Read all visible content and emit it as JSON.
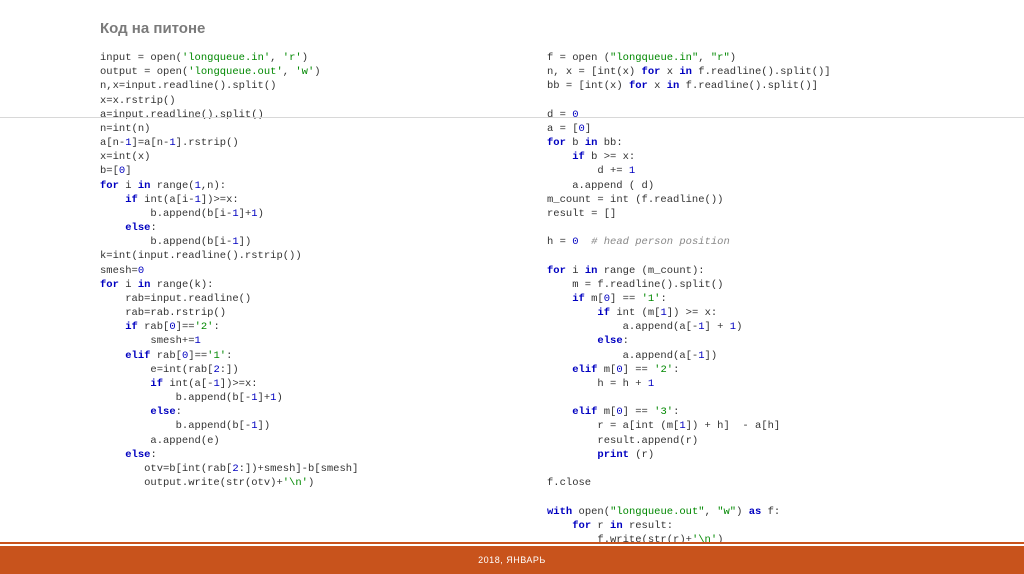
{
  "title": "Код на питоне",
  "footer": "2018, ЯНВАРЬ",
  "code_left": {
    "lines": [
      [
        {
          "t": "input = ",
          "c": "nm"
        },
        {
          "t": "open",
          "c": "nm"
        },
        {
          "t": "(",
          "c": "nm"
        },
        {
          "t": "'longqueue.in'",
          "c": "str"
        },
        {
          "t": ", ",
          "c": "nm"
        },
        {
          "t": "'r'",
          "c": "str"
        },
        {
          "t": ")",
          "c": "nm"
        }
      ],
      [
        {
          "t": "output = ",
          "c": "nm"
        },
        {
          "t": "open",
          "c": "nm"
        },
        {
          "t": "(",
          "c": "nm"
        },
        {
          "t": "'longqueue.out'",
          "c": "str"
        },
        {
          "t": ", ",
          "c": "nm"
        },
        {
          "t": "'w'",
          "c": "str"
        },
        {
          "t": ")",
          "c": "nm"
        }
      ],
      [
        {
          "t": "n,x=input.readline().split()",
          "c": "nm"
        }
      ],
      [
        {
          "t": "x=x.rstrip()",
          "c": "nm"
        }
      ],
      [
        {
          "t": "a=input.readline().split()",
          "c": "nm"
        }
      ],
      [
        {
          "t": "n=",
          "c": "nm"
        },
        {
          "t": "int",
          "c": "nm"
        },
        {
          "t": "(n)",
          "c": "nm"
        }
      ],
      [
        {
          "t": "a[n-",
          "c": "nm"
        },
        {
          "t": "1",
          "c": "num"
        },
        {
          "t": "]=a[n-",
          "c": "nm"
        },
        {
          "t": "1",
          "c": "num"
        },
        {
          "t": "].rstrip()",
          "c": "nm"
        }
      ],
      [
        {
          "t": "x=",
          "c": "nm"
        },
        {
          "t": "int",
          "c": "nm"
        },
        {
          "t": "(x)",
          "c": "nm"
        }
      ],
      [
        {
          "t": "b=[",
          "c": "nm"
        },
        {
          "t": "0",
          "c": "num"
        },
        {
          "t": "]",
          "c": "nm"
        }
      ],
      [
        {
          "t": "for",
          "c": "kw"
        },
        {
          "t": " i ",
          "c": "nm"
        },
        {
          "t": "in",
          "c": "kw"
        },
        {
          "t": " ",
          "c": "nm"
        },
        {
          "t": "range",
          "c": "nm"
        },
        {
          "t": "(",
          "c": "nm"
        },
        {
          "t": "1",
          "c": "num"
        },
        {
          "t": ",n):",
          "c": "nm"
        }
      ],
      [
        {
          "t": "    ",
          "c": "nm"
        },
        {
          "t": "if",
          "c": "kw"
        },
        {
          "t": " ",
          "c": "nm"
        },
        {
          "t": "int",
          "c": "nm"
        },
        {
          "t": "(a[i-",
          "c": "nm"
        },
        {
          "t": "1",
          "c": "num"
        },
        {
          "t": "])>=x:",
          "c": "nm"
        }
      ],
      [
        {
          "t": "        b.append(b[i-",
          "c": "nm"
        },
        {
          "t": "1",
          "c": "num"
        },
        {
          "t": "]+",
          "c": "nm"
        },
        {
          "t": "1",
          "c": "num"
        },
        {
          "t": ")",
          "c": "nm"
        }
      ],
      [
        {
          "t": "    ",
          "c": "nm"
        },
        {
          "t": "else",
          "c": "kw"
        },
        {
          "t": ":",
          "c": "nm"
        }
      ],
      [
        {
          "t": "        b.append(b[i-",
          "c": "nm"
        },
        {
          "t": "1",
          "c": "num"
        },
        {
          "t": "])",
          "c": "nm"
        }
      ],
      [
        {
          "t": "k=",
          "c": "nm"
        },
        {
          "t": "int",
          "c": "nm"
        },
        {
          "t": "(input.readline().rstrip())",
          "c": "nm"
        }
      ],
      [
        {
          "t": "smesh=",
          "c": "nm"
        },
        {
          "t": "0",
          "c": "num"
        }
      ],
      [
        {
          "t": "for",
          "c": "kw"
        },
        {
          "t": " i ",
          "c": "nm"
        },
        {
          "t": "in",
          "c": "kw"
        },
        {
          "t": " ",
          "c": "nm"
        },
        {
          "t": "range",
          "c": "nm"
        },
        {
          "t": "(k):",
          "c": "nm"
        }
      ],
      [
        {
          "t": "    rab=input.readline()",
          "c": "nm"
        }
      ],
      [
        {
          "t": "    rab=rab.rstrip()",
          "c": "nm"
        }
      ],
      [
        {
          "t": "    ",
          "c": "nm"
        },
        {
          "t": "if",
          "c": "kw"
        },
        {
          "t": " rab[",
          "c": "nm"
        },
        {
          "t": "0",
          "c": "num"
        },
        {
          "t": "]==",
          "c": "nm"
        },
        {
          "t": "'2'",
          "c": "str"
        },
        {
          "t": ":",
          "c": "nm"
        }
      ],
      [
        {
          "t": "        smesh+=",
          "c": "nm"
        },
        {
          "t": "1",
          "c": "num"
        }
      ],
      [
        {
          "t": "    ",
          "c": "nm"
        },
        {
          "t": "elif",
          "c": "kw"
        },
        {
          "t": " rab[",
          "c": "nm"
        },
        {
          "t": "0",
          "c": "num"
        },
        {
          "t": "]==",
          "c": "nm"
        },
        {
          "t": "'1'",
          "c": "str"
        },
        {
          "t": ":",
          "c": "nm"
        }
      ],
      [
        {
          "t": "        e=",
          "c": "nm"
        },
        {
          "t": "int",
          "c": "nm"
        },
        {
          "t": "(rab[",
          "c": "nm"
        },
        {
          "t": "2",
          "c": "num"
        },
        {
          "t": ":])",
          "c": "nm"
        }
      ],
      [
        {
          "t": "        ",
          "c": "nm"
        },
        {
          "t": "if",
          "c": "kw"
        },
        {
          "t": " ",
          "c": "nm"
        },
        {
          "t": "int",
          "c": "nm"
        },
        {
          "t": "(a[-",
          "c": "nm"
        },
        {
          "t": "1",
          "c": "num"
        },
        {
          "t": "])>=x:",
          "c": "nm"
        }
      ],
      [
        {
          "t": "            b.append(b[-",
          "c": "nm"
        },
        {
          "t": "1",
          "c": "num"
        },
        {
          "t": "]+",
          "c": "nm"
        },
        {
          "t": "1",
          "c": "num"
        },
        {
          "t": ")",
          "c": "nm"
        }
      ],
      [
        {
          "t": "        ",
          "c": "nm"
        },
        {
          "t": "else",
          "c": "kw"
        },
        {
          "t": ":",
          "c": "nm"
        }
      ],
      [
        {
          "t": "            b.append(b[-",
          "c": "nm"
        },
        {
          "t": "1",
          "c": "num"
        },
        {
          "t": "])",
          "c": "nm"
        }
      ],
      [
        {
          "t": "        a.append(e)",
          "c": "nm"
        }
      ],
      [
        {
          "t": "    ",
          "c": "nm"
        },
        {
          "t": "else",
          "c": "kw"
        },
        {
          "t": ":",
          "c": "nm"
        }
      ],
      [
        {
          "t": "       otv=b[",
          "c": "nm"
        },
        {
          "t": "int",
          "c": "nm"
        },
        {
          "t": "(rab[",
          "c": "nm"
        },
        {
          "t": "2",
          "c": "num"
        },
        {
          "t": ":])+smesh]-b[smesh]",
          "c": "nm"
        }
      ],
      [
        {
          "t": "       output.write(",
          "c": "nm"
        },
        {
          "t": "str",
          "c": "nm"
        },
        {
          "t": "(otv)+",
          "c": "nm"
        },
        {
          "t": "'\\n'",
          "c": "str"
        },
        {
          "t": ")",
          "c": "nm"
        }
      ]
    ]
  },
  "code_right": {
    "lines": [
      [
        {
          "t": "f = ",
          "c": "nm"
        },
        {
          "t": "open",
          "c": "nm"
        },
        {
          "t": " (",
          "c": "nm"
        },
        {
          "t": "\"longqueue.in\"",
          "c": "str"
        },
        {
          "t": ", ",
          "c": "nm"
        },
        {
          "t": "\"r\"",
          "c": "str"
        },
        {
          "t": ")",
          "c": "nm"
        }
      ],
      [
        {
          "t": "n, x = [",
          "c": "nm"
        },
        {
          "t": "int",
          "c": "nm"
        },
        {
          "t": "(x) ",
          "c": "nm"
        },
        {
          "t": "for",
          "c": "kw"
        },
        {
          "t": " x ",
          "c": "nm"
        },
        {
          "t": "in",
          "c": "kw"
        },
        {
          "t": " f.readline().split()]",
          "c": "nm"
        }
      ],
      [
        {
          "t": "bb = [",
          "c": "nm"
        },
        {
          "t": "int",
          "c": "nm"
        },
        {
          "t": "(x) ",
          "c": "nm"
        },
        {
          "t": "for",
          "c": "kw"
        },
        {
          "t": " x ",
          "c": "nm"
        },
        {
          "t": "in",
          "c": "kw"
        },
        {
          "t": " f.readline().split()]",
          "c": "nm"
        }
      ],
      [],
      [
        {
          "t": "d = ",
          "c": "nm"
        },
        {
          "t": "0",
          "c": "num"
        }
      ],
      [
        {
          "t": "a = [",
          "c": "nm"
        },
        {
          "t": "0",
          "c": "num"
        },
        {
          "t": "]",
          "c": "nm"
        }
      ],
      [
        {
          "t": "for",
          "c": "kw"
        },
        {
          "t": " b ",
          "c": "nm"
        },
        {
          "t": "in",
          "c": "kw"
        },
        {
          "t": " bb:",
          "c": "nm"
        }
      ],
      [
        {
          "t": "    ",
          "c": "nm"
        },
        {
          "t": "if",
          "c": "kw"
        },
        {
          "t": " b >= x:",
          "c": "nm"
        }
      ],
      [
        {
          "t": "        d += ",
          "c": "nm"
        },
        {
          "t": "1",
          "c": "num"
        }
      ],
      [
        {
          "t": "    a.append ( d)",
          "c": "nm"
        }
      ],
      [
        {
          "t": "m_count = ",
          "c": "nm"
        },
        {
          "t": "int",
          "c": "nm"
        },
        {
          "t": " (f.readline())",
          "c": "nm"
        }
      ],
      [
        {
          "t": "result = []",
          "c": "nm"
        }
      ],
      [],
      [
        {
          "t": "h = ",
          "c": "nm"
        },
        {
          "t": "0",
          "c": "num"
        },
        {
          "t": "  ",
          "c": "nm"
        },
        {
          "t": "# head person position",
          "c": "cm"
        }
      ],
      [],
      [
        {
          "t": "for",
          "c": "kw"
        },
        {
          "t": " i ",
          "c": "nm"
        },
        {
          "t": "in",
          "c": "kw"
        },
        {
          "t": " ",
          "c": "nm"
        },
        {
          "t": "range",
          "c": "nm"
        },
        {
          "t": " (m_count):",
          "c": "nm"
        }
      ],
      [
        {
          "t": "    m = f.readline().split()",
          "c": "nm"
        }
      ],
      [
        {
          "t": "    ",
          "c": "nm"
        },
        {
          "t": "if",
          "c": "kw"
        },
        {
          "t": " m[",
          "c": "nm"
        },
        {
          "t": "0",
          "c": "num"
        },
        {
          "t": "] == ",
          "c": "nm"
        },
        {
          "t": "'1'",
          "c": "str"
        },
        {
          "t": ":",
          "c": "nm"
        }
      ],
      [
        {
          "t": "        ",
          "c": "nm"
        },
        {
          "t": "if",
          "c": "kw"
        },
        {
          "t": " ",
          "c": "nm"
        },
        {
          "t": "int",
          "c": "nm"
        },
        {
          "t": " (m[",
          "c": "nm"
        },
        {
          "t": "1",
          "c": "num"
        },
        {
          "t": "]) >= x:",
          "c": "nm"
        }
      ],
      [
        {
          "t": "            a.append(a[-",
          "c": "nm"
        },
        {
          "t": "1",
          "c": "num"
        },
        {
          "t": "] + ",
          "c": "nm"
        },
        {
          "t": "1",
          "c": "num"
        },
        {
          "t": ")",
          "c": "nm"
        }
      ],
      [
        {
          "t": "        ",
          "c": "nm"
        },
        {
          "t": "else",
          "c": "kw"
        },
        {
          "t": ":",
          "c": "nm"
        }
      ],
      [
        {
          "t": "            a.append(a[-",
          "c": "nm"
        },
        {
          "t": "1",
          "c": "num"
        },
        {
          "t": "])",
          "c": "nm"
        }
      ],
      [
        {
          "t": "    ",
          "c": "nm"
        },
        {
          "t": "elif",
          "c": "kw"
        },
        {
          "t": " m[",
          "c": "nm"
        },
        {
          "t": "0",
          "c": "num"
        },
        {
          "t": "] == ",
          "c": "nm"
        },
        {
          "t": "'2'",
          "c": "str"
        },
        {
          "t": ":",
          "c": "nm"
        }
      ],
      [
        {
          "t": "        h = h + ",
          "c": "nm"
        },
        {
          "t": "1",
          "c": "num"
        }
      ],
      [],
      [
        {
          "t": "    ",
          "c": "nm"
        },
        {
          "t": "elif",
          "c": "kw"
        },
        {
          "t": " m[",
          "c": "nm"
        },
        {
          "t": "0",
          "c": "num"
        },
        {
          "t": "] == ",
          "c": "nm"
        },
        {
          "t": "'3'",
          "c": "str"
        },
        {
          "t": ":",
          "c": "nm"
        }
      ],
      [
        {
          "t": "        r = a[",
          "c": "nm"
        },
        {
          "t": "int",
          "c": "nm"
        },
        {
          "t": " (m[",
          "c": "nm"
        },
        {
          "t": "1",
          "c": "num"
        },
        {
          "t": "]) + h]  - a[h]",
          "c": "nm"
        }
      ],
      [
        {
          "t": "        result.append(r)",
          "c": "nm"
        }
      ],
      [
        {
          "t": "        ",
          "c": "nm"
        },
        {
          "t": "print",
          "c": "kw"
        },
        {
          "t": " (r)",
          "c": "nm"
        }
      ],
      [],
      [
        {
          "t": "f.close",
          "c": "nm"
        }
      ],
      [],
      [
        {
          "t": "with",
          "c": "kw"
        },
        {
          "t": " ",
          "c": "nm"
        },
        {
          "t": "open",
          "c": "nm"
        },
        {
          "t": "(",
          "c": "nm"
        },
        {
          "t": "\"longqueue.out\"",
          "c": "str"
        },
        {
          "t": ", ",
          "c": "nm"
        },
        {
          "t": "\"w\"",
          "c": "str"
        },
        {
          "t": ") ",
          "c": "nm"
        },
        {
          "t": "as",
          "c": "kw"
        },
        {
          "t": " f:",
          "c": "nm"
        }
      ],
      [
        {
          "t": "    ",
          "c": "nm"
        },
        {
          "t": "for",
          "c": "kw"
        },
        {
          "t": " r ",
          "c": "nm"
        },
        {
          "t": "in",
          "c": "kw"
        },
        {
          "t": " result:",
          "c": "nm"
        }
      ],
      [
        {
          "t": "        f.write(",
          "c": "nm"
        },
        {
          "t": "str",
          "c": "nm"
        },
        {
          "t": "(r)+",
          "c": "nm"
        },
        {
          "t": "'\\n'",
          "c": "str"
        },
        {
          "t": ")",
          "c": "nm"
        }
      ]
    ]
  }
}
